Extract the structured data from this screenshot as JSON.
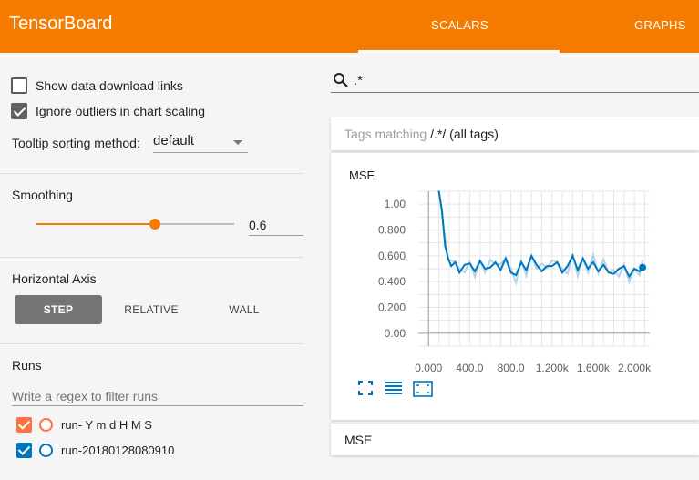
{
  "app": {
    "title": "TensorBoard",
    "tabs": [
      {
        "label": "SCALARS",
        "active": true
      },
      {
        "label": "GRAPHS",
        "active": false
      }
    ]
  },
  "sidebar": {
    "show_download_links": {
      "label": "Show data download links",
      "checked": false
    },
    "ignore_outliers": {
      "label": "Ignore outliers in chart scaling",
      "checked": true
    },
    "tooltip_sorting": {
      "label": "Tooltip sorting method:",
      "value": "default"
    },
    "smoothing": {
      "label": "Smoothing",
      "value": "0.6",
      "fraction": 0.6
    },
    "horizontal_axis": {
      "label": "Horizontal Axis",
      "options": [
        "STEP",
        "RELATIVE",
        "WALL"
      ],
      "selected": "STEP"
    },
    "runs": {
      "label": "Runs",
      "filter_placeholder": "Write a regex to filter runs",
      "items": [
        {
          "label": "run- Y m d H M S",
          "checked": true,
          "color": "#ff7043"
        },
        {
          "label": "run-20180128080910",
          "checked": true,
          "color": "#0077bb"
        }
      ]
    }
  },
  "main": {
    "search": {
      "value": ".*"
    },
    "tags_header": {
      "prefix": "Tags matching ",
      "regex": "/.*/",
      "suffix": " (all tags)"
    },
    "charts": [
      {
        "title": "MSE"
      }
    ],
    "collapsed_group": {
      "label": "MSE"
    }
  },
  "colors": {
    "brand": "#f57c00",
    "series": "#0077bb",
    "series_raw": "#b3d4ea"
  },
  "chart_data": {
    "type": "line",
    "title": "MSE",
    "xlabel": "",
    "ylabel": "",
    "x_ticks": [
      "0.000",
      "400.0",
      "800.0",
      "1.200k",
      "1.600k",
      "2.000k"
    ],
    "y_ticks": [
      "1.00",
      "0.800",
      "0.600",
      "0.400",
      "0.200",
      "0.00"
    ],
    "xlim": [
      -100,
      2150
    ],
    "ylim": [
      -0.1,
      1.1
    ],
    "grid": true,
    "series": [
      {
        "name": "run-20180128080910",
        "x": [
          100,
          130,
          160,
          190,
          220,
          260,
          300,
          350,
          400,
          450,
          500,
          550,
          600,
          650,
          700,
          750,
          800,
          850,
          900,
          950,
          1000,
          1050,
          1100,
          1150,
          1200,
          1250,
          1300,
          1350,
          1400,
          1450,
          1500,
          1550,
          1600,
          1650,
          1700,
          1750,
          1800,
          1850,
          1900,
          1950,
          2000,
          2050,
          2080
        ],
        "y": [
          1.1,
          0.95,
          0.68,
          0.58,
          0.52,
          0.55,
          0.47,
          0.53,
          0.54,
          0.48,
          0.56,
          0.5,
          0.51,
          0.55,
          0.49,
          0.58,
          0.47,
          0.45,
          0.55,
          0.49,
          0.6,
          0.53,
          0.48,
          0.52,
          0.52,
          0.55,
          0.47,
          0.52,
          0.6,
          0.49,
          0.58,
          0.5,
          0.55,
          0.48,
          0.53,
          0.47,
          0.46,
          0.5,
          0.52,
          0.44,
          0.5,
          0.48,
          0.51
        ]
      }
    ]
  }
}
